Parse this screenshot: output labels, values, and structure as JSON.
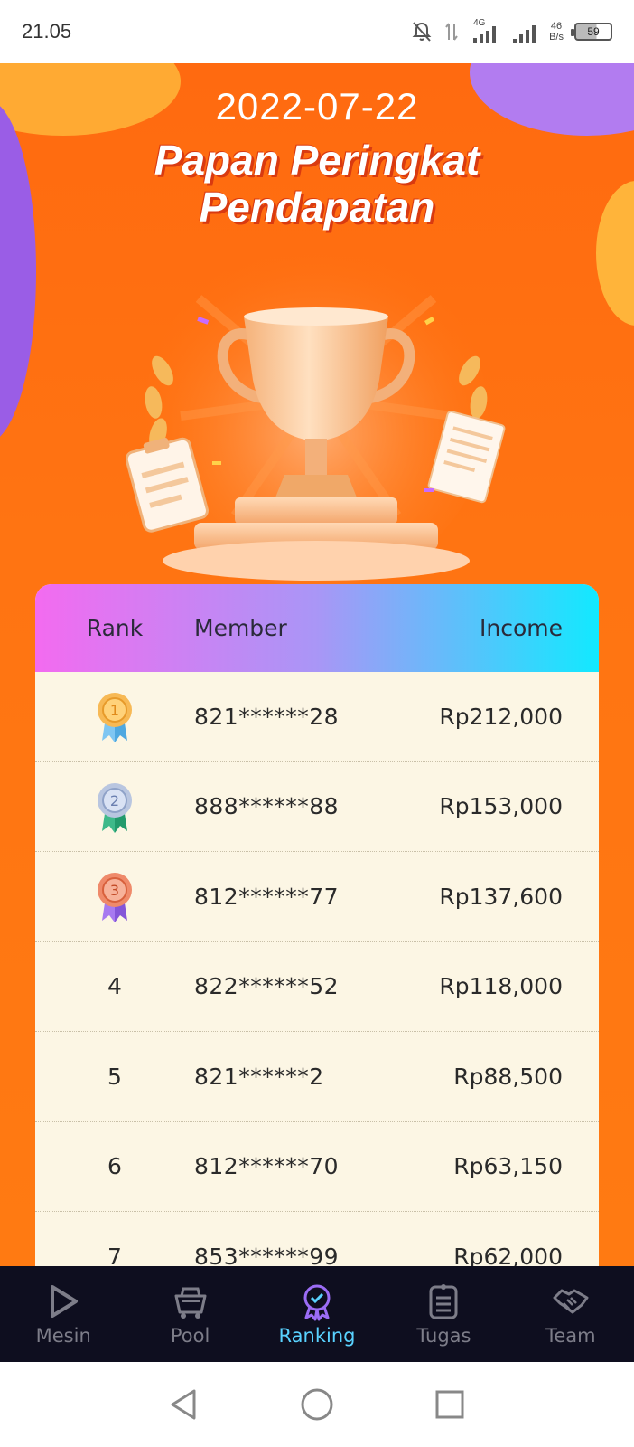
{
  "status_bar": {
    "time": "21.05",
    "network": "4G",
    "speed_value": "46",
    "speed_unit": "B/s",
    "battery": "59"
  },
  "header": {
    "date": "2022-07-22",
    "title_line1": "Papan Peringkat",
    "title_line2": "Pendapatan"
  },
  "table": {
    "columns": {
      "rank": "Rank",
      "member": "Member",
      "income": "Income"
    },
    "rows": [
      {
        "rank": "1",
        "medal": "gold",
        "member": "821******28",
        "income": "Rp212,000"
      },
      {
        "rank": "2",
        "medal": "silver",
        "member": "888******88",
        "income": "Rp153,000"
      },
      {
        "rank": "3",
        "medal": "bronze",
        "member": "812******77",
        "income": "Rp137,600"
      },
      {
        "rank": "4",
        "medal": "",
        "member": "822******52",
        "income": "Rp118,000"
      },
      {
        "rank": "5",
        "medal": "",
        "member": "821******2",
        "income": "Rp88,500"
      },
      {
        "rank": "6",
        "medal": "",
        "member": "812******70",
        "income": "Rp63,150"
      },
      {
        "rank": "7",
        "medal": "",
        "member": "853******99",
        "income": "Rp62,000"
      }
    ]
  },
  "nav": {
    "items": [
      {
        "label": "Mesin",
        "icon": "play-icon",
        "active": false
      },
      {
        "label": "Pool",
        "icon": "mining-cart-icon",
        "active": false
      },
      {
        "label": "Ranking",
        "icon": "ranking-badge-icon",
        "active": true
      },
      {
        "label": "Tugas",
        "icon": "clipboard-icon",
        "active": false
      },
      {
        "label": "Team",
        "icon": "handshake-icon",
        "active": false
      }
    ]
  },
  "colors": {
    "hero_orange": "#ff7412",
    "accent_active": "#59d2ff",
    "nav_bg": "#0e0e1f",
    "table_bg": "#fcf6e4"
  }
}
